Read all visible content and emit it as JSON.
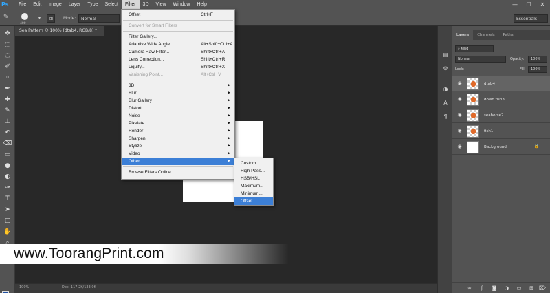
{
  "menubar": {
    "logo": "Ps",
    "items": [
      "File",
      "Edit",
      "Image",
      "Layer",
      "Type",
      "Select",
      "Filter",
      "3D",
      "View",
      "Window",
      "Help"
    ],
    "active": "Filter",
    "window_controls": [
      "—",
      "☐",
      "✕"
    ]
  },
  "options": {
    "brush_size": "400",
    "mode_label": "Mode:",
    "mode_value": "Normal",
    "workspace": "Essentials"
  },
  "document": {
    "tab_title": "Sea Pattern @ 100% (dtab4, RGB/8) *",
    "close": "×"
  },
  "status": {
    "zoom": "100%",
    "doc_info": "Doc: 117.2K/133.0K"
  },
  "filter_menu": {
    "items": [
      {
        "label": "Offset",
        "shortcut": "Ctrl+F",
        "disabled": false
      },
      {
        "sep": true
      },
      {
        "label": "Convert for Smart Filters",
        "disabled": true
      },
      {
        "sep": true
      },
      {
        "label": "Filter Gallery...",
        "disabled": false
      },
      {
        "label": "Adaptive Wide Angle...",
        "shortcut": "Alt+Shift+Ctrl+A",
        "disabled": false
      },
      {
        "label": "Camera Raw Filter...",
        "shortcut": "Shift+Ctrl+A",
        "disabled": false
      },
      {
        "label": "Lens Correction...",
        "shortcut": "Shift+Ctrl+R",
        "disabled": false
      },
      {
        "label": "Liquify...",
        "shortcut": "Shift+Ctrl+X",
        "disabled": false
      },
      {
        "label": "Vanishing Point...",
        "shortcut": "Alt+Ctrl+V",
        "disabled": true
      },
      {
        "sep": true
      },
      {
        "label": "3D",
        "submenu": true
      },
      {
        "label": "Blur",
        "submenu": true
      },
      {
        "label": "Blur Gallery",
        "submenu": true
      },
      {
        "label": "Distort",
        "submenu": true
      },
      {
        "label": "Noise",
        "submenu": true
      },
      {
        "label": "Pixelate",
        "submenu": true
      },
      {
        "label": "Render",
        "submenu": true
      },
      {
        "label": "Sharpen",
        "submenu": true
      },
      {
        "label": "Stylize",
        "submenu": true
      },
      {
        "label": "Video",
        "submenu": true
      },
      {
        "label": "Other",
        "submenu": true,
        "highlighted": true
      },
      {
        "sep": true
      },
      {
        "label": "Browse Filters Online...",
        "disabled": false
      }
    ]
  },
  "other_menu": {
    "items": [
      "Custom...",
      "High Pass...",
      "HSB/HSL",
      "Maximum...",
      "Minimum...",
      "Offset..."
    ],
    "highlighted": "Offset..."
  },
  "layers_panel": {
    "tabs": [
      "Layers",
      "Channels",
      "Paths"
    ],
    "filter_kind": "Kind",
    "blend_mode": "Normal",
    "opacity_label": "Opacity:",
    "opacity_value": "100%",
    "lock_label": "Lock:",
    "fill_label": "Fill:",
    "fill_value": "100%",
    "layers": [
      {
        "name": "dtab4",
        "selected": true,
        "type": "art"
      },
      {
        "name": "down fish3",
        "selected": false,
        "type": "art"
      },
      {
        "name": "seahorse2",
        "selected": false,
        "type": "art"
      },
      {
        "name": "fish1",
        "selected": false,
        "type": "art"
      },
      {
        "name": "Background",
        "selected": false,
        "type": "background"
      }
    ]
  },
  "watermark": "www.ToorangPrint.com",
  "colors": {
    "accent": "#3c7fd6",
    "foreground_swatch": "#1f4fa0",
    "background_swatch": "#000000"
  }
}
